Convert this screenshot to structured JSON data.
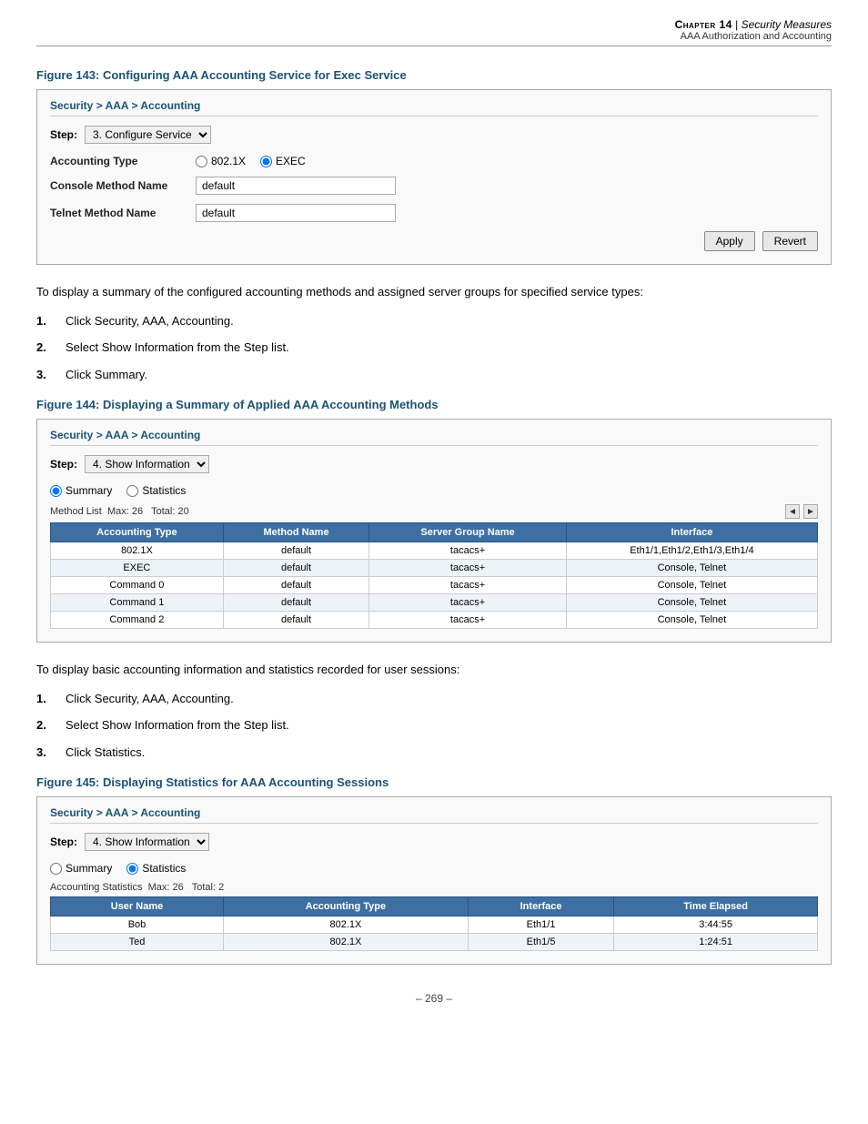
{
  "header": {
    "chapter_label": "Chapter 14",
    "separator": "|",
    "section_title": "Security Measures",
    "sub_section": "AAA Authorization and Accounting"
  },
  "figure143": {
    "caption": "Figure 143:  Configuring AAA Accounting Service for Exec Service",
    "ui_title": "Security > AAA > Accounting",
    "step_label": "Step:",
    "step_value": "3. Configure Service",
    "accounting_type_label": "Accounting Type",
    "radio_802x": "802.1X",
    "radio_exec": "EXEC",
    "console_method_label": "Console Method Name",
    "console_method_value": "default",
    "telnet_method_label": "Telnet Method Name",
    "telnet_method_value": "default",
    "btn_apply": "Apply",
    "btn_revert": "Revert"
  },
  "body1": {
    "text": "To display a summary of the configured accounting methods and assigned server groups for specified service types:"
  },
  "steps1": [
    {
      "num": "1.",
      "text": "Click Security, AAA, Accounting."
    },
    {
      "num": "2.",
      "text": "Select Show Information from the Step list."
    },
    {
      "num": "3.",
      "text": "Click Summary."
    }
  ],
  "figure144": {
    "caption": "Figure 144:  Displaying a Summary of Applied AAA Accounting Methods",
    "ui_title": "Security > AAA > Accounting",
    "step_label": "Step:",
    "step_value": "4. Show Information",
    "radio_summary": "Summary",
    "radio_statistics": "Statistics",
    "method_list_label": "Method List",
    "max_label": "Max: 26",
    "total_label": "Total: 20",
    "columns": [
      "Accounting Type",
      "Method Name",
      "Server Group Name",
      "Interface"
    ],
    "rows": [
      [
        "802.1X",
        "default",
        "tacacs+",
        "Eth1/1,Eth1/2,Eth1/3,Eth1/4"
      ],
      [
        "EXEC",
        "default",
        "tacacs+",
        "Console, Telnet"
      ],
      [
        "Command 0",
        "default",
        "tacacs+",
        "Console, Telnet"
      ],
      [
        "Command 1",
        "default",
        "tacacs+",
        "Console, Telnet"
      ],
      [
        "Command 2",
        "default",
        "tacacs+",
        "Console, Telnet"
      ]
    ]
  },
  "body2": {
    "text": "To display basic accounting information and statistics recorded for user sessions:"
  },
  "steps2": [
    {
      "num": "1.",
      "text": "Click Security, AAA, Accounting."
    },
    {
      "num": "2.",
      "text": "Select Show Information from the Step list."
    },
    {
      "num": "3.",
      "text": "Click Statistics."
    }
  ],
  "figure145": {
    "caption": "Figure 145:  Displaying Statistics for AAA Accounting Sessions",
    "ui_title": "Security > AAA > Accounting",
    "step_label": "Step:",
    "step_value": "4. Show Information",
    "radio_summary": "Summary",
    "radio_statistics": "Statistics",
    "accounting_stats_label": "Accounting Statistics",
    "max_label": "Max: 26",
    "total_label": "Total: 2",
    "columns": [
      "User Name",
      "Accounting Type",
      "Interface",
      "Time Elapsed"
    ],
    "rows": [
      [
        "Bob",
        "802.1X",
        "Eth1/1",
        "3:44:55"
      ],
      [
        "Ted",
        "802.1X",
        "Eth1/5",
        "1:24:51"
      ]
    ]
  },
  "page_number": "–  269  –"
}
